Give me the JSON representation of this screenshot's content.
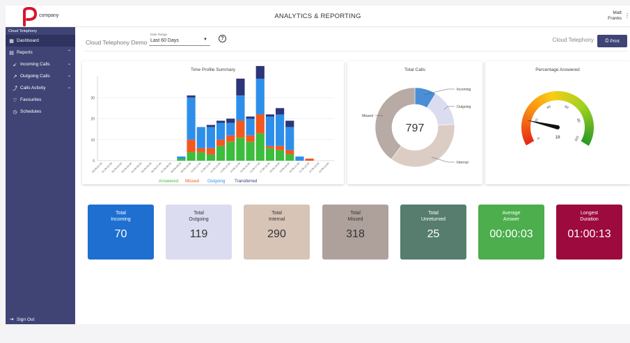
{
  "header": {
    "logo_text": "company",
    "title": "ANALYTICS & REPORTING",
    "user_first": "Matt",
    "user_last": "Franks"
  },
  "sidebar": {
    "brand": "Cloud Telephony",
    "items": [
      {
        "label": "Dashboard",
        "icon": "dashboard-icon"
      },
      {
        "label": "Reports",
        "icon": "table-icon"
      },
      {
        "label": "Incoming Calls",
        "icon": "arrow-down-left-icon"
      },
      {
        "label": "Outgoing Calls",
        "icon": "arrow-up-right-icon"
      },
      {
        "label": "Calls Activity",
        "icon": "trend-icon"
      },
      {
        "label": "Favourites",
        "icon": "heart-icon"
      },
      {
        "label": "Schedules",
        "icon": "clock-icon"
      }
    ],
    "sign_out": "Sign Out"
  },
  "filter": {
    "title": "Cloud Telephony Demo",
    "range_label": "Date Range",
    "range_value": "Last 60 Days",
    "right_label": "Cloud Telephony",
    "print_label": "Print"
  },
  "colors": {
    "sidebar": "#3f4475",
    "answered": "#3dbd3d",
    "missed": "#f2581f",
    "outgoing": "#2e8fea",
    "transferred": "#2d3478"
  },
  "chart_data": [
    {
      "type": "bar",
      "title": "Time Profile Summary",
      "stacked": true,
      "ylim": [
        0,
        40
      ],
      "yticks": [
        0,
        10,
        20,
        30
      ],
      "categories": [
        "00:00-01:00",
        "01:00-02:00",
        "02:00-03:00",
        "03:00-04:00",
        "04:00-05:00",
        "05:00-06:00",
        "06:00-07:00",
        "07:00-08:00",
        "08:00-09:00",
        "09:00-10:00",
        "10:00-11:00",
        "11:00-12:00",
        "12:00-13:00",
        "13:00-14:00",
        "14:00-15:00",
        "15:00-16:00",
        "16:00-17:00",
        "17:00-18:00",
        "18:00-19:00",
        "19:00-20:00",
        "20:00-21:00",
        "21:00-22:00",
        "22:00-23:00",
        "23:00-24:00"
      ],
      "series": [
        {
          "name": "Answered",
          "color": "#3dbd3d",
          "values": [
            0,
            0,
            0,
            0,
            0,
            0,
            0,
            0,
            1,
            4,
            4,
            3,
            7,
            9,
            11,
            9,
            13,
            6,
            5,
            3,
            0,
            0,
            0,
            0
          ]
        },
        {
          "name": "Missed",
          "color": "#f2581f",
          "values": [
            0,
            0,
            0,
            0,
            0,
            0,
            0,
            0,
            0,
            6,
            2,
            3,
            3,
            3,
            8,
            3,
            9,
            1,
            2,
            2,
            0,
            1,
            0,
            0
          ]
        },
        {
          "name": "Outgoing",
          "color": "#2e8fea",
          "values": [
            0,
            0,
            0,
            0,
            0,
            0,
            0,
            0,
            1,
            20,
            10,
            10,
            8,
            6,
            12,
            8,
            17,
            14,
            15,
            11,
            2,
            0,
            0,
            0
          ]
        },
        {
          "name": "Transferred",
          "color": "#2d3478",
          "values": [
            0,
            0,
            0,
            0,
            0,
            0,
            0,
            0,
            0,
            1,
            0,
            1,
            1,
            2,
            8,
            1,
            6,
            1,
            3,
            3,
            0,
            0,
            0,
            0
          ]
        }
      ]
    },
    {
      "type": "pie",
      "title": "Total Calls",
      "total": "797",
      "slices": [
        {
          "label": "Incoming",
          "value": 70,
          "color": "#4a8fd6"
        },
        {
          "label": "Outgoing",
          "value": 119,
          "color": "#dcdcf0"
        },
        {
          "label": "Internal",
          "value": 290,
          "color": "#dccdc4"
        },
        {
          "label": "Missed",
          "value": 318,
          "color": "#b8aaa4"
        }
      ]
    },
    {
      "type": "gauge",
      "title": "Percentage Answered",
      "value": 18,
      "min": 0,
      "max": 100,
      "ticks": [
        0,
        20,
        40,
        60,
        80,
        100
      ]
    }
  ],
  "tiles": [
    {
      "line1": "Total",
      "line2": "Incoming",
      "value": "70",
      "bg": "#1e6fd0",
      "fg": "#ffffff"
    },
    {
      "line1": "Total",
      "line2": "Outgoing",
      "value": "119",
      "bg": "#dcdcf0",
      "fg": "#333333"
    },
    {
      "line1": "Total",
      "line2": "Internal",
      "value": "290",
      "bg": "#d7c4b7",
      "fg": "#333333"
    },
    {
      "line1": "Total",
      "line2": "Missed",
      "value": "318",
      "bg": "#aea19b",
      "fg": "#333333"
    },
    {
      "line1": "Total",
      "line2": "Unreturned",
      "value": "25",
      "bg": "#567d6d",
      "fg": "#ffffff"
    },
    {
      "line1": "Average",
      "line2": "Answer",
      "value": "00:00:03",
      "bg": "#4cae4c",
      "fg": "#ffffff"
    },
    {
      "line1": "Longest",
      "line2": "Duration",
      "value": "01:00:13",
      "bg": "#9c0a3e",
      "fg": "#ffffff"
    }
  ]
}
